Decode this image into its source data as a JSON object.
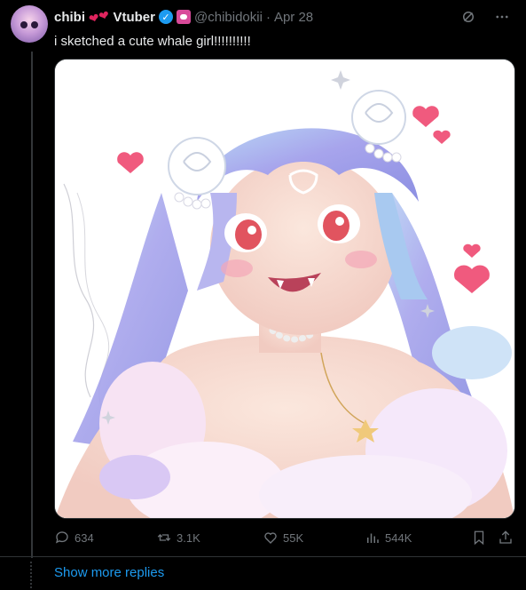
{
  "tweet": {
    "author_name": "chibi",
    "author_name_suffix": "Vtuber",
    "handle": "@chibidokii",
    "separator": "·",
    "date": "Apr 28",
    "text": "i sketched a cute whale girl!!!!!!!!!!"
  },
  "actions": {
    "replies": "634",
    "retweets": "3.1K",
    "likes": "55K",
    "views": "544K"
  },
  "footer": {
    "show_more": "Show more replies"
  },
  "colors": {
    "accent": "#1d9bf0",
    "background": "#000000",
    "muted": "#71767b",
    "text": "#e7e9ea"
  },
  "icons": [
    "verified-icon",
    "affiliate-badge-icon",
    "grok-icon",
    "more-icon",
    "reply-icon",
    "retweet-icon",
    "like-icon",
    "views-icon",
    "bookmark-icon",
    "share-icon"
  ]
}
